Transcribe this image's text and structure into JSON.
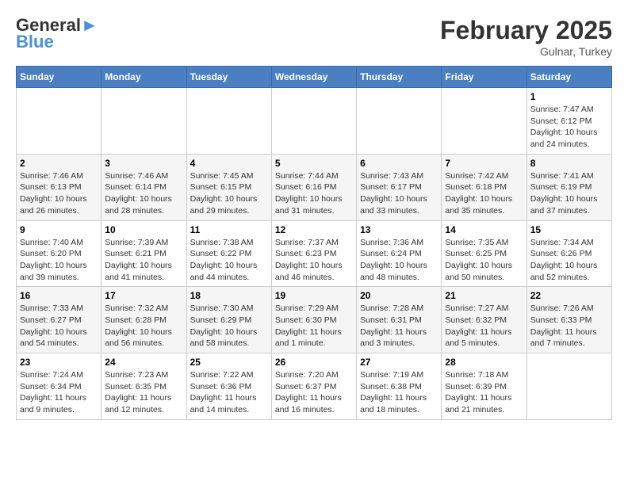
{
  "header": {
    "logo_line1": "General",
    "logo_line2": "Blue",
    "month": "February 2025",
    "location": "Gulnar, Turkey"
  },
  "weekdays": [
    "Sunday",
    "Monday",
    "Tuesday",
    "Wednesday",
    "Thursday",
    "Friday",
    "Saturday"
  ],
  "weeks": [
    [
      {
        "day": "",
        "info": ""
      },
      {
        "day": "",
        "info": ""
      },
      {
        "day": "",
        "info": ""
      },
      {
        "day": "",
        "info": ""
      },
      {
        "day": "",
        "info": ""
      },
      {
        "day": "",
        "info": ""
      },
      {
        "day": "1",
        "info": "Sunrise: 7:47 AM\nSunset: 6:12 PM\nDaylight: 10 hours and 24 minutes."
      }
    ],
    [
      {
        "day": "2",
        "info": "Sunrise: 7:46 AM\nSunset: 6:13 PM\nDaylight: 10 hours and 26 minutes."
      },
      {
        "day": "3",
        "info": "Sunrise: 7:46 AM\nSunset: 6:14 PM\nDaylight: 10 hours and 28 minutes."
      },
      {
        "day": "4",
        "info": "Sunrise: 7:45 AM\nSunset: 6:15 PM\nDaylight: 10 hours and 29 minutes."
      },
      {
        "day": "5",
        "info": "Sunrise: 7:44 AM\nSunset: 6:16 PM\nDaylight: 10 hours and 31 minutes."
      },
      {
        "day": "6",
        "info": "Sunrise: 7:43 AM\nSunset: 6:17 PM\nDaylight: 10 hours and 33 minutes."
      },
      {
        "day": "7",
        "info": "Sunrise: 7:42 AM\nSunset: 6:18 PM\nDaylight: 10 hours and 35 minutes."
      },
      {
        "day": "8",
        "info": "Sunrise: 7:41 AM\nSunset: 6:19 PM\nDaylight: 10 hours and 37 minutes."
      }
    ],
    [
      {
        "day": "9",
        "info": "Sunrise: 7:40 AM\nSunset: 6:20 PM\nDaylight: 10 hours and 39 minutes."
      },
      {
        "day": "10",
        "info": "Sunrise: 7:39 AM\nSunset: 6:21 PM\nDaylight: 10 hours and 41 minutes."
      },
      {
        "day": "11",
        "info": "Sunrise: 7:38 AM\nSunset: 6:22 PM\nDaylight: 10 hours and 44 minutes."
      },
      {
        "day": "12",
        "info": "Sunrise: 7:37 AM\nSunset: 6:23 PM\nDaylight: 10 hours and 46 minutes."
      },
      {
        "day": "13",
        "info": "Sunrise: 7:36 AM\nSunset: 6:24 PM\nDaylight: 10 hours and 48 minutes."
      },
      {
        "day": "14",
        "info": "Sunrise: 7:35 AM\nSunset: 6:25 PM\nDaylight: 10 hours and 50 minutes."
      },
      {
        "day": "15",
        "info": "Sunrise: 7:34 AM\nSunset: 6:26 PM\nDaylight: 10 hours and 52 minutes."
      }
    ],
    [
      {
        "day": "16",
        "info": "Sunrise: 7:33 AM\nSunset: 6:27 PM\nDaylight: 10 hours and 54 minutes."
      },
      {
        "day": "17",
        "info": "Sunrise: 7:32 AM\nSunset: 6:28 PM\nDaylight: 10 hours and 56 minutes."
      },
      {
        "day": "18",
        "info": "Sunrise: 7:30 AM\nSunset: 6:29 PM\nDaylight: 10 hours and 58 minutes."
      },
      {
        "day": "19",
        "info": "Sunrise: 7:29 AM\nSunset: 6:30 PM\nDaylight: 11 hours and 1 minute."
      },
      {
        "day": "20",
        "info": "Sunrise: 7:28 AM\nSunset: 6:31 PM\nDaylight: 11 hours and 3 minutes."
      },
      {
        "day": "21",
        "info": "Sunrise: 7:27 AM\nSunset: 6:32 PM\nDaylight: 11 hours and 5 minutes."
      },
      {
        "day": "22",
        "info": "Sunrise: 7:26 AM\nSunset: 6:33 PM\nDaylight: 11 hours and 7 minutes."
      }
    ],
    [
      {
        "day": "23",
        "info": "Sunrise: 7:24 AM\nSunset: 6:34 PM\nDaylight: 11 hours and 9 minutes."
      },
      {
        "day": "24",
        "info": "Sunrise: 7:23 AM\nSunset: 6:35 PM\nDaylight: 11 hours and 12 minutes."
      },
      {
        "day": "25",
        "info": "Sunrise: 7:22 AM\nSunset: 6:36 PM\nDaylight: 11 hours and 14 minutes."
      },
      {
        "day": "26",
        "info": "Sunrise: 7:20 AM\nSunset: 6:37 PM\nDaylight: 11 hours and 16 minutes."
      },
      {
        "day": "27",
        "info": "Sunrise: 7:19 AM\nSunset: 6:38 PM\nDaylight: 11 hours and 18 minutes."
      },
      {
        "day": "28",
        "info": "Sunrise: 7:18 AM\nSunset: 6:39 PM\nDaylight: 11 hours and 21 minutes."
      },
      {
        "day": "",
        "info": ""
      }
    ]
  ]
}
